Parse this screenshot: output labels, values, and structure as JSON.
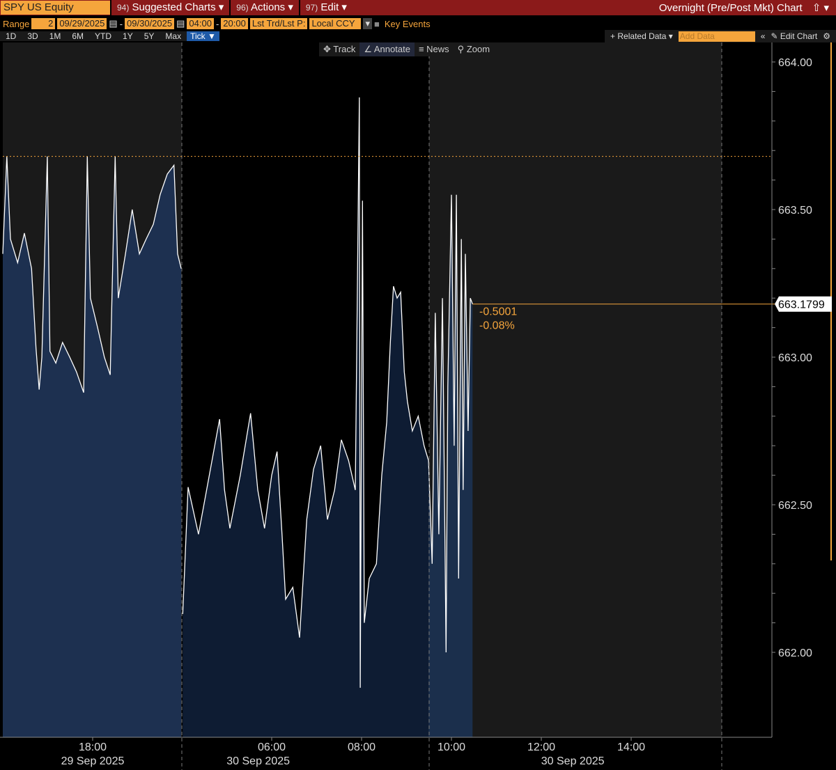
{
  "header": {
    "ticker": "SPY US Equity",
    "menus": [
      {
        "num": "94)",
        "label": "Suggested Charts ▾"
      },
      {
        "num": "96)",
        "label": "Actions ▾"
      },
      {
        "num": "97)",
        "label": "Edit ▾"
      }
    ],
    "title": "Overnight (Pre/Post Mkt) Chart",
    "share": "⇧ ▾"
  },
  "controls": {
    "range_label": "Range",
    "range": "2",
    "start_date": "09/29/2025",
    "end_date": "09/30/2025",
    "start_time": "04:00",
    "end_time": "20:00",
    "price_type": "Lst Trd/Lst P:",
    "currency": "Local CCY",
    "key_events": "Key Events"
  },
  "periods": [
    "1D",
    "3D",
    "1M",
    "6M",
    "YTD",
    "1Y",
    "5Y",
    "Max"
  ],
  "tick": "Tick ▼",
  "right_tools": {
    "related": "+ Related Data ▾",
    "add_placeholder": "Add Data",
    "collapse": "«",
    "edit": "✎ Edit Chart",
    "gear": "⚙"
  },
  "tools": [
    {
      "icon": "✥",
      "label": "Track"
    },
    {
      "icon": "∠",
      "label": "Annotate"
    },
    {
      "icon": "≡",
      "label": "News"
    },
    {
      "icon": "⚲",
      "label": "Zoom"
    }
  ],
  "last": {
    "price": "663.1799",
    "change": "-0.5001",
    "pct": "-0.08%"
  },
  "colors": {
    "accent": "#f5a53c",
    "fill_day1": "#1d3050",
    "fill_pre": "#0e1c33",
    "fill_mkt": "#1b2f4c"
  },
  "chart_data": {
    "type": "area",
    "ylim": [
      661.75,
      664.05
    ],
    "yticks": [
      "664.00",
      "663.50",
      "663.00",
      "662.50",
      "662.00"
    ],
    "reference_price": 663.68,
    "xticks": [
      {
        "label": "18:00",
        "day": 1,
        "h": 18
      },
      {
        "label": "06:00",
        "day": 2,
        "h": 6
      },
      {
        "label": "08:00",
        "day": 2,
        "h": 8
      },
      {
        "label": "10:00",
        "day": 2,
        "h": 10
      },
      {
        "label": "12:00",
        "day": 2,
        "h": 12
      },
      {
        "label": "14:00",
        "day": 2,
        "h": 14
      }
    ],
    "date_labels": [
      {
        "label": "29 Sep 2025",
        "day": 1,
        "h": 18
      },
      {
        "label": "30 Sep 2025",
        "day": 2,
        "h": 5.7
      },
      {
        "label": "30 Sep 2025",
        "day": 2,
        "h": 12.7
      }
    ],
    "series1": [
      [
        16,
        663.35
      ],
      [
        16.09,
        663.68
      ],
      [
        16.17,
        663.4
      ],
      [
        16.33,
        663.32
      ],
      [
        16.48,
        663.42
      ],
      [
        16.64,
        663.3
      ],
      [
        16.74,
        663.03
      ],
      [
        16.81,
        662.89
      ],
      [
        16.87,
        663
      ],
      [
        16.99,
        663.68
      ],
      [
        17.05,
        663.02
      ],
      [
        17.18,
        662.98
      ],
      [
        17.33,
        663.05
      ],
      [
        17.49,
        663
      ],
      [
        17.64,
        662.95
      ],
      [
        17.8,
        662.88
      ],
      [
        17.88,
        663.68
      ],
      [
        17.95,
        663.2
      ],
      [
        18.11,
        663.1
      ],
      [
        18.26,
        663
      ],
      [
        18.39,
        662.94
      ],
      [
        18.5,
        663.68
      ],
      [
        18.57,
        663.2
      ],
      [
        18.73,
        663.35
      ],
      [
        18.88,
        663.5
      ],
      [
        19.04,
        663.35
      ],
      [
        19.19,
        663.4
      ],
      [
        19.35,
        663.45
      ],
      [
        19.5,
        663.55
      ],
      [
        19.66,
        663.62
      ],
      [
        19.81,
        663.65
      ],
      [
        19.89,
        663.35
      ],
      [
        19.97,
        663.3
      ]
    ],
    "series2": [
      [
        4.02,
        662.13
      ],
      [
        4.14,
        662.56
      ],
      [
        4.37,
        662.4
      ],
      [
        4.6,
        662.59
      ],
      [
        4.84,
        662.79
      ],
      [
        4.95,
        662.55
      ],
      [
        5.07,
        662.42
      ],
      [
        5.3,
        662.6
      ],
      [
        5.53,
        662.81
      ],
      [
        5.69,
        662.55
      ],
      [
        5.84,
        662.42
      ],
      [
        6,
        662.6
      ],
      [
        6.12,
        662.68
      ],
      [
        6.23,
        662.4
      ],
      [
        6.31,
        662.18
      ],
      [
        6.47,
        662.22
      ],
      [
        6.62,
        662.05
      ],
      [
        6.78,
        662.45
      ],
      [
        6.93,
        662.62
      ],
      [
        7.09,
        662.7
      ],
      [
        7.24,
        662.45
      ],
      [
        7.4,
        662.55
      ],
      [
        7.55,
        662.72
      ],
      [
        7.71,
        662.65
      ],
      [
        7.86,
        662.55
      ],
      [
        7.95,
        663.88
      ],
      [
        7.97,
        661.88
      ],
      [
        8.02,
        663.53
      ],
      [
        8.06,
        662.1
      ],
      [
        8.17,
        662.25
      ],
      [
        8.33,
        662.3
      ],
      [
        8.45,
        662.6
      ],
      [
        8.56,
        662.78
      ],
      [
        8.64,
        663.05
      ],
      [
        8.71,
        663.24
      ],
      [
        8.79,
        663.2
      ],
      [
        8.87,
        663.22
      ],
      [
        8.95,
        662.95
      ],
      [
        9.02,
        662.85
      ],
      [
        9.13,
        662.75
      ],
      [
        9.26,
        662.8
      ],
      [
        9.39,
        662.7
      ],
      [
        9.49,
        662.65
      ],
      [
        9.57,
        662.3
      ],
      [
        9.64,
        663.15
      ],
      [
        9.72,
        662.4
      ],
      [
        9.8,
        663.2
      ],
      [
        9.88,
        662
      ],
      [
        9.92,
        662.9
      ],
      [
        10,
        663.55
      ],
      [
        10.06,
        662.7
      ],
      [
        10.11,
        663.55
      ],
      [
        10.16,
        662.25
      ],
      [
        10.22,
        663.4
      ],
      [
        10.26,
        662.55
      ],
      [
        10.31,
        663.35
      ],
      [
        10.37,
        662.75
      ],
      [
        10.42,
        663.2
      ],
      [
        10.47,
        663.18
      ]
    ]
  }
}
